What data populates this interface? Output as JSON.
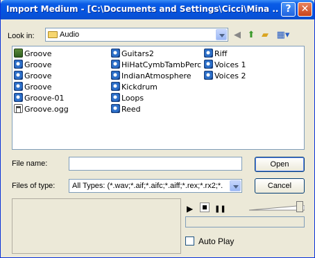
{
  "window": {
    "title": "Import Medium - [C:\\Documents and Settings\\Cicci\\Mina ...",
    "help_glyph": "?",
    "close_glyph": "✕"
  },
  "toolbar": {
    "look_in_label": "Look in:",
    "look_in_value": "Audio",
    "icons": [
      "back-icon",
      "up-folder-icon",
      "new-folder-icon",
      "views-menu-icon"
    ]
  },
  "files": {
    "col1": [
      {
        "name": "Groove",
        "icon": "groove"
      },
      {
        "name": "Groove",
        "icon": "audio"
      },
      {
        "name": "Groove",
        "icon": "audio"
      },
      {
        "name": "Groove",
        "icon": "audio"
      },
      {
        "name": "Groove-01",
        "icon": "audio"
      },
      {
        "name": "Groove.ogg",
        "icon": "ogg"
      }
    ],
    "col2": [
      {
        "name": "Guitars2",
        "icon": "audio"
      },
      {
        "name": "HiHatCymbTambPerc",
        "icon": "audio"
      },
      {
        "name": "IndianAtmosphere",
        "icon": "audio"
      },
      {
        "name": "Kickdrum",
        "icon": "audio"
      },
      {
        "name": "Loops",
        "icon": "audio"
      },
      {
        "name": "Reed",
        "icon": "audio"
      }
    ],
    "col3": [
      {
        "name": "Riff",
        "icon": "audio"
      },
      {
        "name": "Voices 1",
        "icon": "audio"
      },
      {
        "name": "Voices 2",
        "icon": "audio"
      }
    ]
  },
  "form": {
    "file_name_label": "File name:",
    "file_name_value": "",
    "files_of_type_label": "Files of type:",
    "files_of_type_value": "All Types: (*.wav;*.aif;*.aifc;*.aiff;*.rex;*.rx2;*.",
    "open_label": "Open",
    "cancel_label": "Cancel"
  },
  "player": {
    "play_glyph": "▶",
    "pause_glyph": "❚❚",
    "autoplay_label": "Auto Play",
    "autoplay_checked": false,
    "volume_fraction": 0.9,
    "progress_fraction": 0
  }
}
